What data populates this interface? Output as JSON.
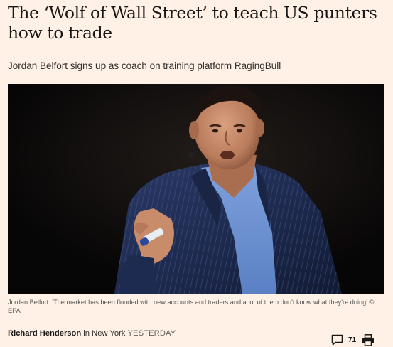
{
  "article": {
    "headline": "The ‘Wolf of Wall Street’ to teach US punters how to trade",
    "standfirst": "Jordan Belfort signs up as coach on training platform RagingBull",
    "caption": "Jordan Belfort: 'The market has been flooded with new accounts and traders and a lot of them don't know what they're doing' © EPA",
    "byline": {
      "author": "Richard Henderson",
      "location_prefix": " in New York ",
      "date": "YESTERDAY"
    },
    "comments": {
      "count": "71",
      "icon": "speech-bubble-icon"
    },
    "print_icon": "printer-icon"
  },
  "colors": {
    "page_background": "#fff1e5",
    "headline": "#1a1817",
    "text": "#33302e",
    "photo_background": "#0b0a0a"
  }
}
